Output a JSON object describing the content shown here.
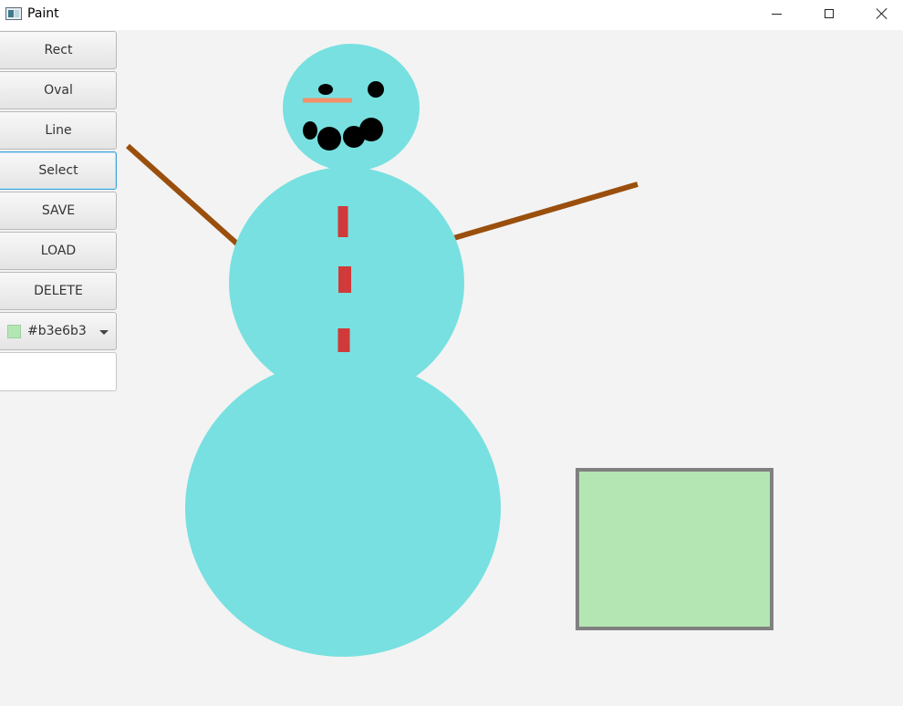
{
  "window": {
    "title": "Paint"
  },
  "toolbar": {
    "buttons": [
      {
        "label": "Rect"
      },
      {
        "label": "Oval"
      },
      {
        "label": "Line"
      },
      {
        "label": "Select",
        "selected": true
      },
      {
        "label": "SAVE"
      },
      {
        "label": "LOAD"
      },
      {
        "label": "DELETE"
      }
    ],
    "color_picker": {
      "value": "#b3e6b3",
      "swatch_color": "#b3e6b3"
    },
    "text_input": {
      "value": "",
      "placeholder": ""
    }
  },
  "canvas": {
    "colors": {
      "body": "#78e0e0",
      "arms": "#9a4f0d",
      "buttons": "#d03a3a",
      "nose": "#f2906a",
      "eyes_mouth": "#000000",
      "rect_fill": "#b3e6b3",
      "rect_stroke": "#808080",
      "background": "#f3f3f3"
    }
  }
}
